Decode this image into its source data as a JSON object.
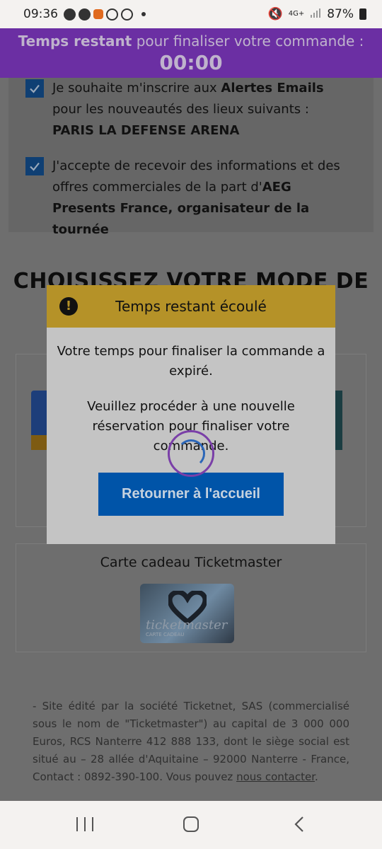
{
  "status_bar": {
    "time": "09:36",
    "network": "4G+",
    "battery": "87%"
  },
  "timer_banner": {
    "label_bold": "Temps restant",
    "label_rest": "pour finaliser votre commande :",
    "time": "00:00"
  },
  "consents": [
    {
      "text_a": "Je souhaite m'inscrire aux ",
      "bold_a": "Alertes Emails",
      "text_b": " pour les nouveautés des lieux suivants : ",
      "bold_b": "PARIS LA DEFENSE ARENA",
      "checked": true
    },
    {
      "text_a": "J'accepte de recevoir des informations et des offres commerciales de la part d'",
      "bold_a": "AEG Presents France, organisateur de la tournée",
      "checked": true
    }
  ],
  "section_title": "CHOISISSEZ VOTRE MODE DE",
  "gift_card": {
    "label": "Carte cadeau Ticketmaster",
    "image_brand": "ticketmaster",
    "image_sub": "CARTE CADEAU"
  },
  "footer": {
    "text": "- Site édité par la société Ticketnet, SAS (commercialisé sous le nom de \"Ticketmaster\") au capital de 3 000 000 Euros, RCS Nanterre 412 888 133, dont le siège social est situé au – 28 allée d'Aquitaine – 92000 Nanterre - France, Contact : 0892-390-100. Vous pouvez ",
    "link": "nous contacter",
    "end": "."
  },
  "modal": {
    "title": "Temps restant écoulé",
    "message1": "Votre temps pour finaliser la commande a expiré.",
    "message2": "Veuillez procéder à une nouvelle réservation pour finaliser votre commande.",
    "button": "Retourner à l'accueil"
  },
  "colors": {
    "timer_banner": "#6b2fa3",
    "modal_header": "#b59228",
    "primary_button": "#0054a8",
    "checkbox": "#0f3f73"
  }
}
